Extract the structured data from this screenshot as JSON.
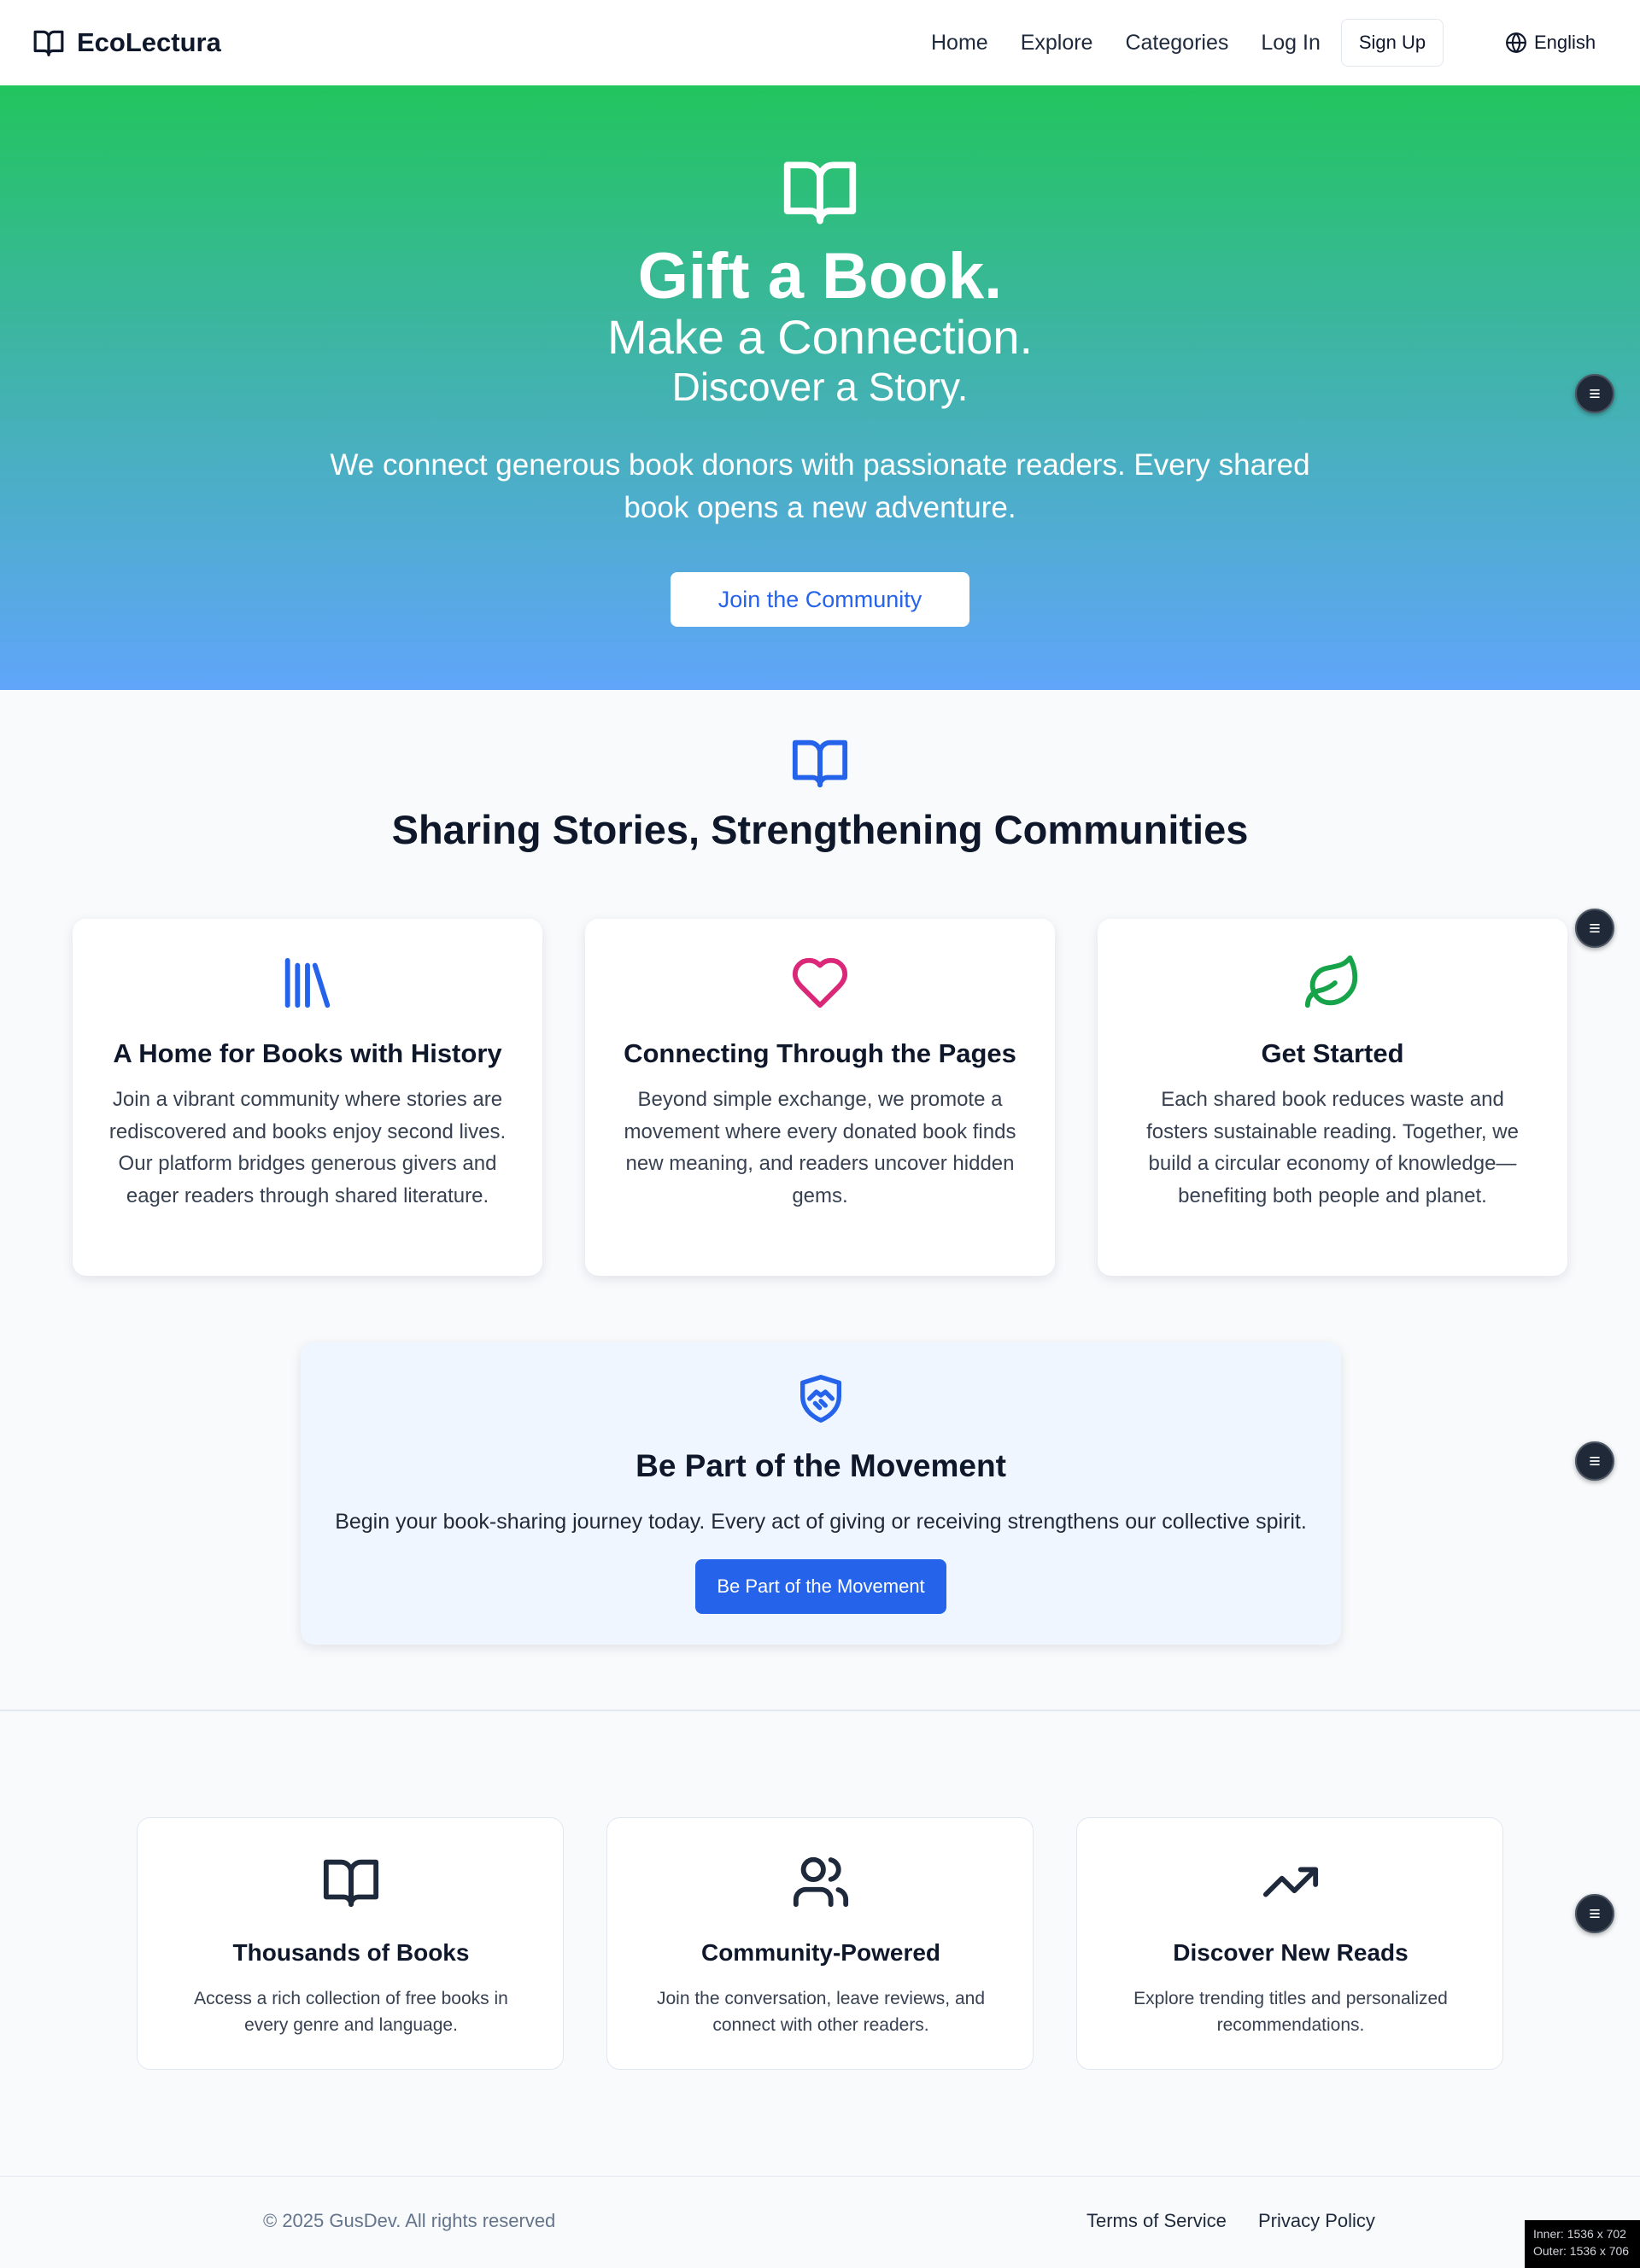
{
  "nav": {
    "brand": "EcoLectura",
    "links": [
      "Home",
      "Explore",
      "Categories",
      "Log In"
    ],
    "signup": "Sign Up",
    "language": "English"
  },
  "hero": {
    "title": "Gift a Book.",
    "subtitle": "Make a Connection.",
    "tagline": "Discover a Story.",
    "description": "We connect generous book donors with passionate readers. Every shared book opens a new adventure.",
    "cta": "Join the Community"
  },
  "mission": {
    "title": "Sharing Stories, Strengthening Communities",
    "cards": [
      {
        "icon": "library-icon",
        "title": "A Home for Books with History",
        "text": "Join a vibrant community where stories are rediscovered and books enjoy second lives. Our platform bridges generous givers and eager readers through shared literature."
      },
      {
        "icon": "heart-icon",
        "title": "Connecting Through the Pages",
        "text": "Beyond simple exchange, we promote a movement where every donated book finds new meaning, and readers uncover hidden gems."
      },
      {
        "icon": "leaf-icon",
        "title": "Get Started",
        "text": "Each shared book reduces waste and fosters sustainable reading. Together, we build a circular economy of knowledge—benefiting both people and planet."
      }
    ]
  },
  "movement": {
    "title": "Be Part of the Movement",
    "text": "Begin your book-sharing journey today. Every act of giving or receiving strengthens our collective spirit.",
    "cta": "Be Part of the Movement"
  },
  "features": [
    {
      "icon": "book-open-icon",
      "title": "Thousands of Books",
      "text": "Access a rich collection of free books in every genre and language."
    },
    {
      "icon": "users-icon",
      "title": "Community-Powered",
      "text": "Join the conversation, leave reviews, and connect with other readers."
    },
    {
      "icon": "trending-up-icon",
      "title": "Discover New Reads",
      "text": "Explore trending titles and personalized recommendations."
    }
  ],
  "footer": {
    "copyright": "© 2025 GusDev. All rights reserved",
    "links": [
      "Terms of Service",
      "Privacy Policy"
    ]
  },
  "overlay": {
    "inner": "Inner: 1536 x 702",
    "outer": "Outer: 1536 x 706"
  },
  "colors": {
    "primary": "#2563eb",
    "hero_top": "#22c55e",
    "hero_bottom": "#60a5fa",
    "heart": "#db2777",
    "leaf": "#16a34a",
    "text_dark": "#0f172a"
  }
}
